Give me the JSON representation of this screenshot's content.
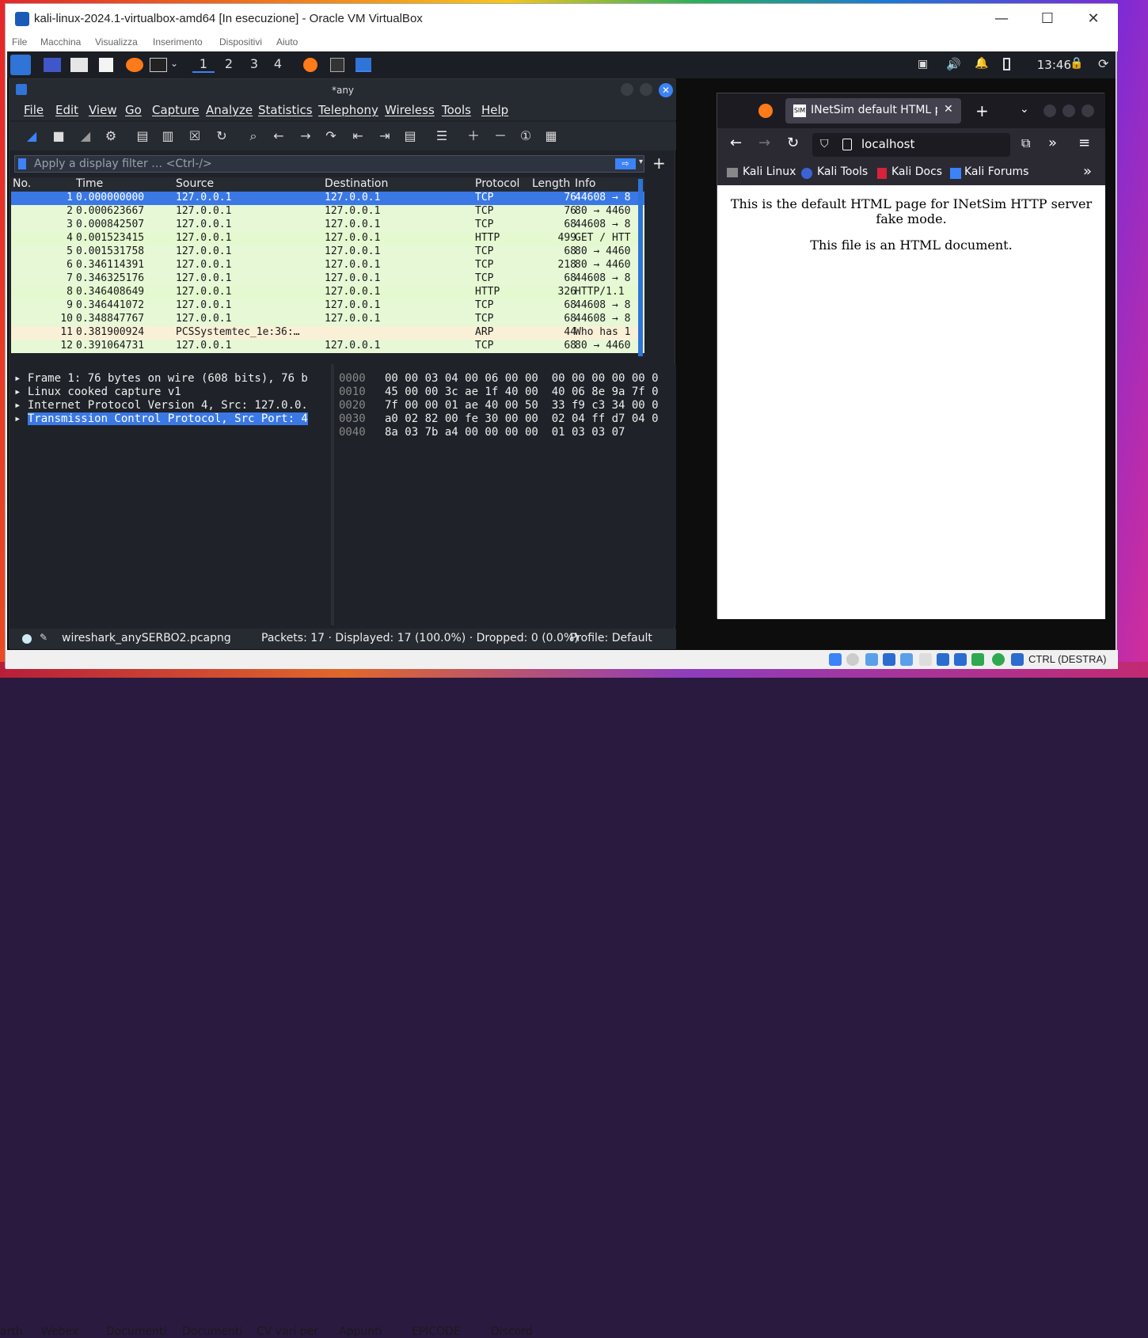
{
  "desktop": {
    "taskbar": [
      "arth",
      "Webex",
      "Documenti",
      "Documenti",
      "CV vari per",
      "Appunti",
      "EPICODE",
      "Discord"
    ]
  },
  "vbox": {
    "title": "kali-linux-2024.1-virtualbox-amd64 [In esecuzione] - Oracle VM VirtualBox",
    "menu": [
      "File",
      "Macchina",
      "Visualizza",
      "Inserimento",
      "Dispositivi",
      "Aiuto"
    ],
    "status_host_key": "CTRL (DESTRA)"
  },
  "kali": {
    "workspaces": [
      "1",
      "2",
      "3",
      "4"
    ],
    "clock": "13:46"
  },
  "wireshark": {
    "title": "*any",
    "menu": [
      "File",
      "Edit",
      "View",
      "Go",
      "Capture",
      "Analyze",
      "Statistics",
      "Telephony",
      "Wireless",
      "Tools",
      "Help"
    ],
    "filter_placeholder": "Apply a display filter … <Ctrl-/>",
    "columns": [
      "No.",
      "Time",
      "Source",
      "Destination",
      "Protocol",
      "Length",
      "Info"
    ],
    "packets": [
      {
        "no": "1",
        "time": "0.000000000",
        "src": "127.0.0.1",
        "dst": "127.0.0.1",
        "proto": "TCP",
        "len": "76",
        "info": "44608 → 8"
      },
      {
        "no": "2",
        "time": "0.000623667",
        "src": "127.0.0.1",
        "dst": "127.0.0.1",
        "proto": "TCP",
        "len": "76",
        "info": "80 → 4460"
      },
      {
        "no": "3",
        "time": "0.000842507",
        "src": "127.0.0.1",
        "dst": "127.0.0.1",
        "proto": "TCP",
        "len": "68",
        "info": "44608 → 8"
      },
      {
        "no": "4",
        "time": "0.001523415",
        "src": "127.0.0.1",
        "dst": "127.0.0.1",
        "proto": "HTTP",
        "len": "499",
        "info": "GET / HTT"
      },
      {
        "no": "5",
        "time": "0.001531758",
        "src": "127.0.0.1",
        "dst": "127.0.0.1",
        "proto": "TCP",
        "len": "68",
        "info": "80 → 4460"
      },
      {
        "no": "6",
        "time": "0.346114391",
        "src": "127.0.0.1",
        "dst": "127.0.0.1",
        "proto": "TCP",
        "len": "218",
        "info": "80 → 4460"
      },
      {
        "no": "7",
        "time": "0.346325176",
        "src": "127.0.0.1",
        "dst": "127.0.0.1",
        "proto": "TCP",
        "len": "68",
        "info": "44608 → 8"
      },
      {
        "no": "8",
        "time": "0.346408649",
        "src": "127.0.0.1",
        "dst": "127.0.0.1",
        "proto": "HTTP",
        "len": "326",
        "info": "HTTP/1.1"
      },
      {
        "no": "9",
        "time": "0.346441072",
        "src": "127.0.0.1",
        "dst": "127.0.0.1",
        "proto": "TCP",
        "len": "68",
        "info": "44608 → 8"
      },
      {
        "no": "10",
        "time": "0.348847767",
        "src": "127.0.0.1",
        "dst": "127.0.0.1",
        "proto": "TCP",
        "len": "68",
        "info": "44608 → 8"
      },
      {
        "no": "11",
        "time": "0.381900924",
        "src": "PCSSystemtec_1e:36:…",
        "dst": "",
        "proto": "ARP",
        "len": "44",
        "info": "Who has 1"
      },
      {
        "no": "12",
        "time": "0.391064731",
        "src": "127.0.0.1",
        "dst": "127.0.0.1",
        "proto": "TCP",
        "len": "68",
        "info": "80 → 4460"
      }
    ],
    "details": [
      "Frame 1: 76 bytes on wire (608 bits), 76 b",
      "Linux cooked capture v1",
      "Internet Protocol Version 4, Src: 127.0.0.",
      "Transmission Control Protocol, Src Port: 4"
    ],
    "hex": [
      {
        "off": "0000",
        "bytes": "00 00 03 04 00 06 00 00  00 00 00 00 00 0"
      },
      {
        "off": "0010",
        "bytes": "45 00 00 3c ae 1f 40 00  40 06 8e 9a 7f 0"
      },
      {
        "off": "0020",
        "bytes": "7f 00 00 01 ae 40 00 50  33 f9 c3 34 00 0"
      },
      {
        "off": "0030",
        "bytes": "a0 02 82 00 fe 30 00 00  02 04 ff d7 04 0"
      },
      {
        "off": "0040",
        "bytes": "8a 03 7b a4 00 00 00 00  01 03 03 07"
      }
    ],
    "status_file": "wireshark_anySERBO2.pcapng",
    "status_packets": "Packets: 17 · Displayed: 17 (100.0%) · Dropped: 0 (0.0%)",
    "status_profile": "Profile: Default"
  },
  "firefox": {
    "tab_title": "INetSim default HTML pa",
    "url": "localhost",
    "bookmarks": [
      "Kali Linux",
      "Kali Tools",
      "Kali Docs",
      "Kali Forums"
    ],
    "content_p1": "This is the default HTML page for INetSim HTTP server fake mode.",
    "content_p2": "This file is an HTML document."
  }
}
